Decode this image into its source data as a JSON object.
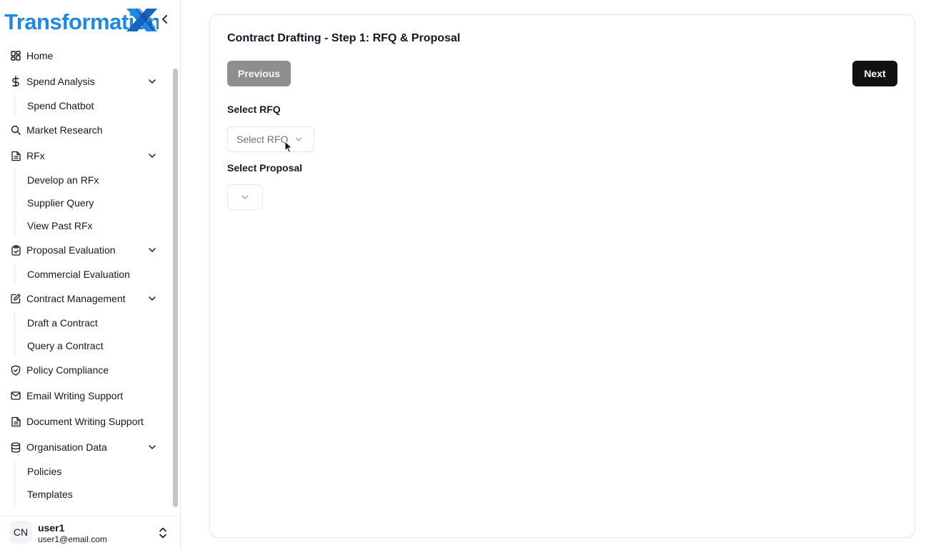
{
  "brand": {
    "logo_text_part1": "Transformation",
    "logo_text_part2": "X",
    "colors": {
      "blue": "#1e88e5",
      "dark_blue": "#1565c0"
    }
  },
  "sidebar": {
    "items": [
      {
        "label": "Home",
        "icon": "grid-icon"
      },
      {
        "label": "Spend Analysis",
        "icon": "dollar-icon",
        "expanded": true,
        "children": [
          "Spend Chatbot"
        ]
      },
      {
        "label": "Market Research",
        "icon": "search-icon"
      },
      {
        "label": "RFx",
        "icon": "file-text-icon",
        "expanded": true,
        "children": [
          "Develop an RFx",
          "Supplier Query",
          "View Past RFx"
        ]
      },
      {
        "label": "Proposal Evaluation",
        "icon": "clipboard-check-icon",
        "expanded": true,
        "children": [
          "Commercial Evaluation"
        ]
      },
      {
        "label": "Contract Management",
        "icon": "edit-icon",
        "expanded": true,
        "children": [
          "Draft a Contract",
          "Query a Contract"
        ]
      },
      {
        "label": "Policy Compliance",
        "icon": "shield-check-icon"
      },
      {
        "label": "Email Writing Support",
        "icon": "mail-icon"
      },
      {
        "label": "Document Writing Support",
        "icon": "file-text-icon"
      },
      {
        "label": "Organisation Data",
        "icon": "database-icon",
        "expanded": true,
        "children": [
          "Policies",
          "Templates"
        ]
      }
    ]
  },
  "user": {
    "initials": "CN",
    "name": "user1",
    "email": "user1@email.com"
  },
  "main": {
    "title": "Contract Drafting - Step 1: RFQ & Proposal",
    "previous_label": "Previous",
    "next_label": "Next",
    "rfq": {
      "label": "Select RFQ",
      "placeholder": "Select RFQ"
    },
    "proposal": {
      "label": "Select Proposal",
      "placeholder": ""
    }
  }
}
